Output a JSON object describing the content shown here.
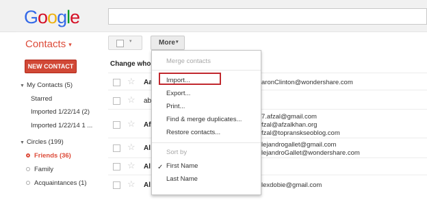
{
  "logo": {
    "letters": [
      "G",
      "o",
      "o",
      "g",
      "l",
      "e"
    ],
    "colors": [
      "#3369e8",
      "#d50f25",
      "#eeb211",
      "#3369e8",
      "#009925",
      "#d50f25"
    ]
  },
  "header": {
    "title": "Contacts",
    "caret": "▾"
  },
  "toolbar": {
    "select_arrow": "▾",
    "more_label": "More",
    "more_arrow": "▾"
  },
  "sidebar": {
    "new_contact": "NEW CONTACT",
    "my_contacts": "My Contacts (5)",
    "items": [
      "Starred",
      "Imported 1/22/14 (2)",
      "Imported 1/22/14 1 ..."
    ],
    "circles": "Circles (199)",
    "circle_items": [
      "Friends (36)",
      "Family",
      "Acquaintances (1)"
    ]
  },
  "list": {
    "header": "Change who's",
    "rows": [
      {
        "name": "Aa",
        "emails": [
          "aronClinton@wondershare.com"
        ]
      },
      {
        "name": "ab",
        "emails": []
      },
      {
        "name": "Af",
        "emails": [
          "7.afzal@gmail.com",
          "fzal@afzalkhan.org",
          "fzal@topranskseoblog.com"
        ]
      },
      {
        "name": "Al",
        "emails": [
          "lejandrogallet@gmail.com",
          "lejandroGallet@wondershare.com"
        ]
      },
      {
        "name": "Al",
        "emails": []
      },
      {
        "name": "Al",
        "emails": [
          "lexdobie@gmail.com"
        ]
      }
    ]
  },
  "menu": {
    "merge": "Merge contacts",
    "items": [
      "Import...",
      "Export...",
      "Print...",
      "Find & merge duplicates...",
      "Restore contacts..."
    ],
    "sort_by": "Sort by",
    "sort_items": [
      "First Name",
      "Last Name"
    ],
    "check": "✓"
  },
  "colors": {
    "accent": "#dd4b39",
    "new_contact_bg": "#d14836",
    "highlight": "#c0272d"
  }
}
